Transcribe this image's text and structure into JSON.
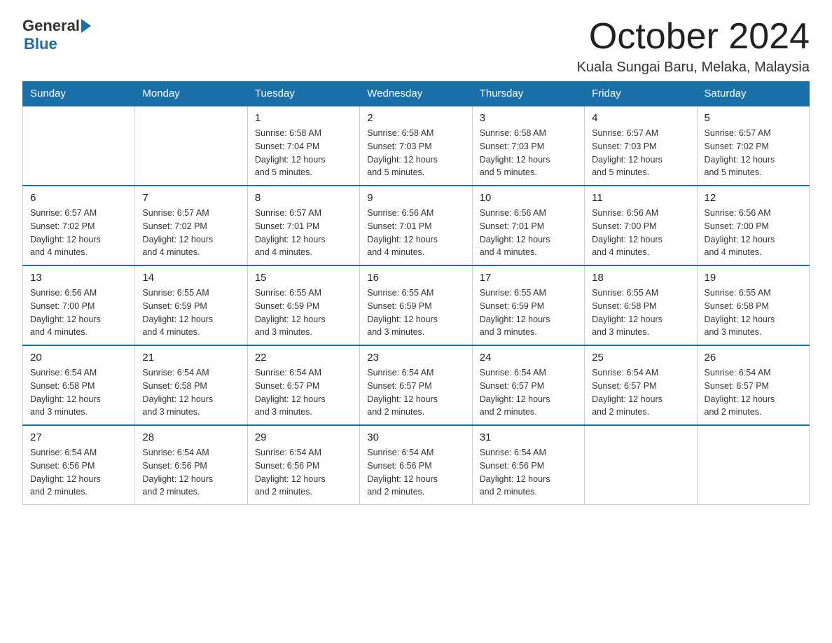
{
  "header": {
    "logo_general": "General",
    "logo_blue": "Blue",
    "title": "October 2024",
    "subtitle": "Kuala Sungai Baru, Melaka, Malaysia"
  },
  "weekdays": [
    "Sunday",
    "Monday",
    "Tuesday",
    "Wednesday",
    "Thursday",
    "Friday",
    "Saturday"
  ],
  "weeks": [
    [
      {
        "day": "",
        "info": ""
      },
      {
        "day": "",
        "info": ""
      },
      {
        "day": "1",
        "info": "Sunrise: 6:58 AM\nSunset: 7:04 PM\nDaylight: 12 hours\nand 5 minutes."
      },
      {
        "day": "2",
        "info": "Sunrise: 6:58 AM\nSunset: 7:03 PM\nDaylight: 12 hours\nand 5 minutes."
      },
      {
        "day": "3",
        "info": "Sunrise: 6:58 AM\nSunset: 7:03 PM\nDaylight: 12 hours\nand 5 minutes."
      },
      {
        "day": "4",
        "info": "Sunrise: 6:57 AM\nSunset: 7:03 PM\nDaylight: 12 hours\nand 5 minutes."
      },
      {
        "day": "5",
        "info": "Sunrise: 6:57 AM\nSunset: 7:02 PM\nDaylight: 12 hours\nand 5 minutes."
      }
    ],
    [
      {
        "day": "6",
        "info": "Sunrise: 6:57 AM\nSunset: 7:02 PM\nDaylight: 12 hours\nand 4 minutes."
      },
      {
        "day": "7",
        "info": "Sunrise: 6:57 AM\nSunset: 7:02 PM\nDaylight: 12 hours\nand 4 minutes."
      },
      {
        "day": "8",
        "info": "Sunrise: 6:57 AM\nSunset: 7:01 PM\nDaylight: 12 hours\nand 4 minutes."
      },
      {
        "day": "9",
        "info": "Sunrise: 6:56 AM\nSunset: 7:01 PM\nDaylight: 12 hours\nand 4 minutes."
      },
      {
        "day": "10",
        "info": "Sunrise: 6:56 AM\nSunset: 7:01 PM\nDaylight: 12 hours\nand 4 minutes."
      },
      {
        "day": "11",
        "info": "Sunrise: 6:56 AM\nSunset: 7:00 PM\nDaylight: 12 hours\nand 4 minutes."
      },
      {
        "day": "12",
        "info": "Sunrise: 6:56 AM\nSunset: 7:00 PM\nDaylight: 12 hours\nand 4 minutes."
      }
    ],
    [
      {
        "day": "13",
        "info": "Sunrise: 6:56 AM\nSunset: 7:00 PM\nDaylight: 12 hours\nand 4 minutes."
      },
      {
        "day": "14",
        "info": "Sunrise: 6:55 AM\nSunset: 6:59 PM\nDaylight: 12 hours\nand 4 minutes."
      },
      {
        "day": "15",
        "info": "Sunrise: 6:55 AM\nSunset: 6:59 PM\nDaylight: 12 hours\nand 3 minutes."
      },
      {
        "day": "16",
        "info": "Sunrise: 6:55 AM\nSunset: 6:59 PM\nDaylight: 12 hours\nand 3 minutes."
      },
      {
        "day": "17",
        "info": "Sunrise: 6:55 AM\nSunset: 6:59 PM\nDaylight: 12 hours\nand 3 minutes."
      },
      {
        "day": "18",
        "info": "Sunrise: 6:55 AM\nSunset: 6:58 PM\nDaylight: 12 hours\nand 3 minutes."
      },
      {
        "day": "19",
        "info": "Sunrise: 6:55 AM\nSunset: 6:58 PM\nDaylight: 12 hours\nand 3 minutes."
      }
    ],
    [
      {
        "day": "20",
        "info": "Sunrise: 6:54 AM\nSunset: 6:58 PM\nDaylight: 12 hours\nand 3 minutes."
      },
      {
        "day": "21",
        "info": "Sunrise: 6:54 AM\nSunset: 6:58 PM\nDaylight: 12 hours\nand 3 minutes."
      },
      {
        "day": "22",
        "info": "Sunrise: 6:54 AM\nSunset: 6:57 PM\nDaylight: 12 hours\nand 3 minutes."
      },
      {
        "day": "23",
        "info": "Sunrise: 6:54 AM\nSunset: 6:57 PM\nDaylight: 12 hours\nand 2 minutes."
      },
      {
        "day": "24",
        "info": "Sunrise: 6:54 AM\nSunset: 6:57 PM\nDaylight: 12 hours\nand 2 minutes."
      },
      {
        "day": "25",
        "info": "Sunrise: 6:54 AM\nSunset: 6:57 PM\nDaylight: 12 hours\nand 2 minutes."
      },
      {
        "day": "26",
        "info": "Sunrise: 6:54 AM\nSunset: 6:57 PM\nDaylight: 12 hours\nand 2 minutes."
      }
    ],
    [
      {
        "day": "27",
        "info": "Sunrise: 6:54 AM\nSunset: 6:56 PM\nDaylight: 12 hours\nand 2 minutes."
      },
      {
        "day": "28",
        "info": "Sunrise: 6:54 AM\nSunset: 6:56 PM\nDaylight: 12 hours\nand 2 minutes."
      },
      {
        "day": "29",
        "info": "Sunrise: 6:54 AM\nSunset: 6:56 PM\nDaylight: 12 hours\nand 2 minutes."
      },
      {
        "day": "30",
        "info": "Sunrise: 6:54 AM\nSunset: 6:56 PM\nDaylight: 12 hours\nand 2 minutes."
      },
      {
        "day": "31",
        "info": "Sunrise: 6:54 AM\nSunset: 6:56 PM\nDaylight: 12 hours\nand 2 minutes."
      },
      {
        "day": "",
        "info": ""
      },
      {
        "day": "",
        "info": ""
      }
    ]
  ]
}
